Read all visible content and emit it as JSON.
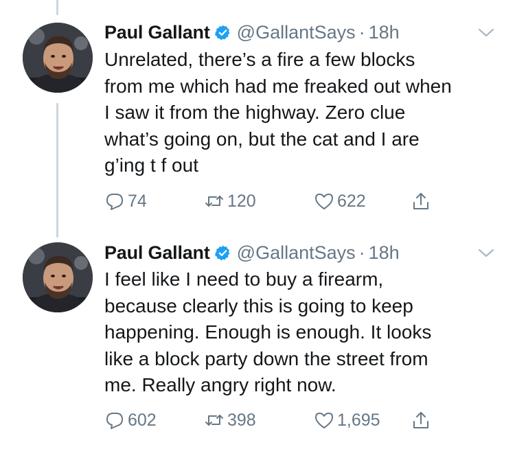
{
  "tweets": [
    {
      "display_name": "Paul Gallant",
      "handle": "@GallantSays",
      "separator": "·",
      "time": "18h",
      "text": "Unrelated, there’s a fire a few blocks\nfrom me which had me freaked out when\nI saw it from the highway. Zero clue\nwhat’s going on, but the cat and I are\ng’ing t f out",
      "replies": "74",
      "retweets": "120",
      "likes": "622"
    },
    {
      "display_name": "Paul Gallant",
      "handle": "@GallantSays",
      "separator": "·",
      "time": "18h",
      "text": "I feel like I need to buy a firearm,\nbecause clearly this is going to keep\nhappening. Enough is enough. It looks\nlike a block party down the street from\nme. Really angry right now.",
      "replies": "602",
      "retweets": "398",
      "likes": "1,695"
    }
  ],
  "icons": {
    "verified": "verified-badge-icon",
    "caret": "chevron-down-icon",
    "reply": "reply-icon",
    "retweet": "retweet-icon",
    "like": "heart-icon",
    "share": "share-icon"
  },
  "colors": {
    "verified": "#1da1f2",
    "secondary_text": "#657786",
    "primary_text": "#14171a",
    "thread_line": "#ccd6dd"
  }
}
